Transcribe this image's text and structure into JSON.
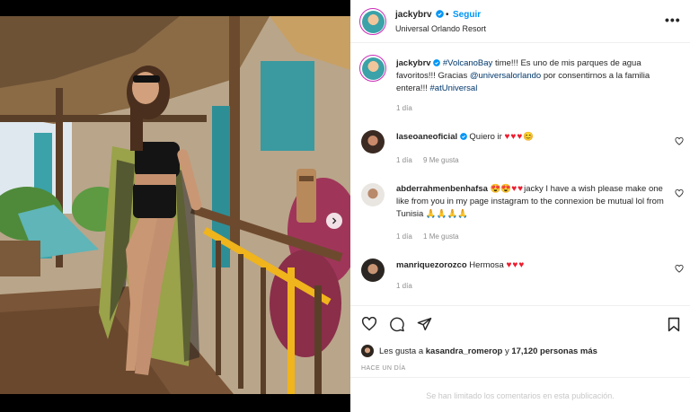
{
  "header": {
    "username": "jackybrv",
    "follow_label": "Seguir",
    "separator": "•",
    "location": "Universal Orlando Resort",
    "more": "•••"
  },
  "caption": {
    "username": "jackybrv",
    "hashtag_volcano": "#VolcanoBay",
    "text1": " time!!! Es uno de mis parques de agua favoritos!!! Gracias ",
    "mention": "@universalorlando",
    "text2": " por consentirnos a la familia entera!!! ",
    "hashtag_at": "#atUniversal",
    "age": "1 día"
  },
  "comments": [
    {
      "username": "laseoaneoficial",
      "text": "Quiero ir ",
      "emoji": "♥♥♥",
      "extra": "😊",
      "age": "1 día",
      "likes": "9 Me gusta"
    },
    {
      "username": "abderrahmenbenhafsa",
      "text": "jacky I have a wish please make one like from you in my page instagram to the connexion be mutual lol from Tunisia ",
      "prefix_emoji": "😍😍",
      "hearts": "♥♥",
      "suffix_emoji": "🙏🙏🙏🙏",
      "age": "1 día",
      "likes": "1 Me gusta"
    },
    {
      "username": "manriquezorozco",
      "text": "Hermosa ",
      "emoji": "♥♥♥",
      "age": "1 día"
    }
  ],
  "likes_line": {
    "prefix": "Les gusta a ",
    "user": "kasandra_romerop",
    "middle": " y ",
    "count": "17,120 personas más"
  },
  "timestamp": "HACE UN DÍA",
  "comments_limited": "Se han limitado los comentarios en esta publicación.",
  "colors": {
    "accent": "#0095f6",
    "heart": "#ed1c2e",
    "muted": "#8e8e8e"
  }
}
